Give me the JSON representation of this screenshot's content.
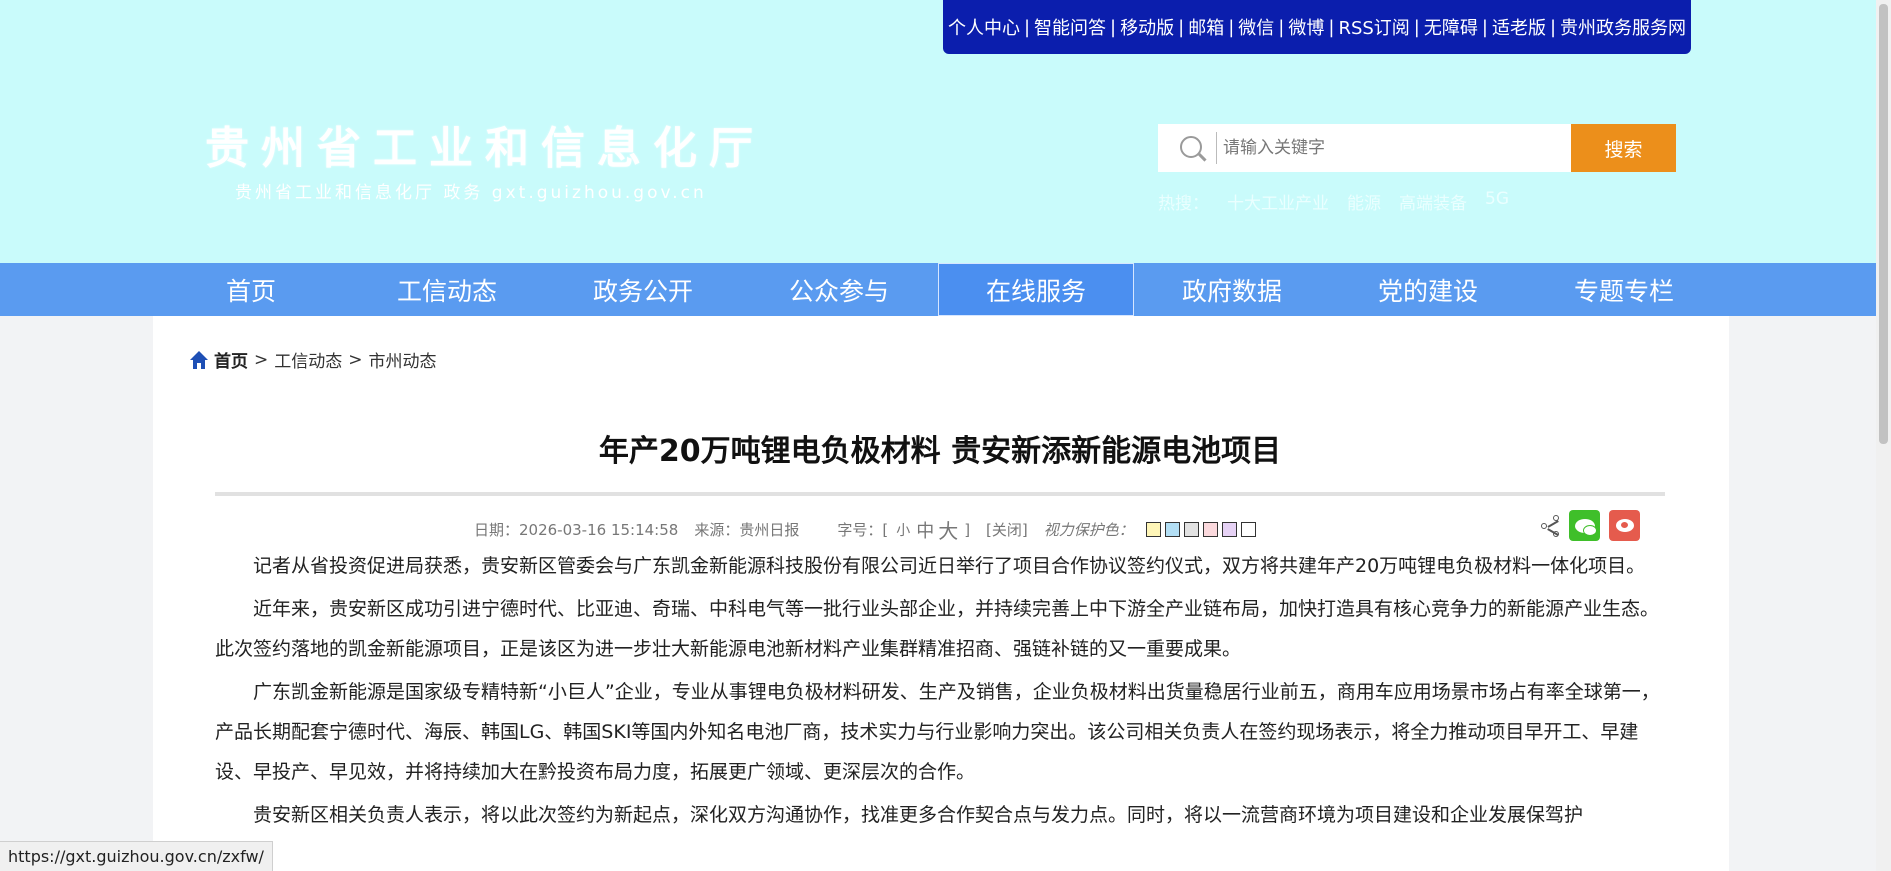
{
  "header": {
    "top_links": [
      "个人中心",
      "智能问答",
      "移动版",
      "邮箱",
      "微信",
      "微博",
      "RSS订阅",
      "无障碍",
      "适老版",
      "贵州政务服务网"
    ],
    "logo_title": "贵州省工业和信息化厅",
    "logo_subtitle": "贵州省工业和信息化厅 政务   gxt.guizhou.gov.cn",
    "search": {
      "placeholder": "请输入关键字",
      "button_label": "搜索"
    },
    "hot_label": "热搜：",
    "hot_terms": [
      "十大工业产业",
      "能源",
      "高端装备",
      "5G"
    ]
  },
  "nav": {
    "items": [
      "首页",
      "工信动态",
      "政务公开",
      "公众参与",
      "在线服务",
      "政府数据",
      "党的建设",
      "专题专栏"
    ],
    "active_index": 4
  },
  "breadcrumb": {
    "home": "首页",
    "items": [
      "工信动态",
      "市州动态"
    ],
    "separator": ">"
  },
  "article": {
    "title": "年产20万吨锂电负极材料 贵安新添新能源电池项目",
    "date": "日期：2026-03-16 15:14:58",
    "source": "来源：贵州日报",
    "font_label": "字号：[",
    "font_small": "小",
    "font_medium": "中",
    "font_large": "大",
    "font_close": "]",
    "close_label": "[关闭]",
    "sight_label": "视力保护色：",
    "sight_colors": [
      "#fff6b8",
      "#b3dff5",
      "#e2e2e2",
      "#fbd9dd",
      "#e6d2f5",
      "#ffffff"
    ],
    "paragraphs": [
      "记者从省投资促进局获悉，贵安新区管委会与广东凯金新能源科技股份有限公司近日举行了项目合作协议签约仪式，双方将共建年产20万吨锂电负极材料一体化项目。",
      "近年来，贵安新区成功引进宁德时代、比亚迪、奇瑞、中科电气等一批行业头部企业，并持续完善上中下游全产业链布局，加快打造具有核心竞争力的新能源产业生态。此次签约落地的凯金新能源项目，正是该区为进一步壮大新能源电池新材料产业集群精准招商、强链补链的又一重要成果。",
      "广东凯金新能源是国家级专精特新“小巨人”企业，专业从事锂电负极材料研发、生产及销售，企业负极材料出货量稳居行业前五，商用车应用场景市场占有率全球第一，产品长期配套宁德时代、海辰、韩国LG、韩国SKI等国内外知名电池厂商，技术实力与行业影响力突出。该公司相关负责人在签约现场表示，将全力推动项目早开工、早建设、早投产、早见效，并将持续加大在黔投资布局力度，拓展更广领域、更深层次的合作。",
      "贵安新区相关负责人表示，将以此次签约为新起点，深化双方沟通协作，找准更多合作契合点与发力点。同时，将以一流营商环境为项目建设和企业发展保驾护"
    ]
  },
  "status_url": "https://gxt.guizhou.gov.cn/zxfw/"
}
